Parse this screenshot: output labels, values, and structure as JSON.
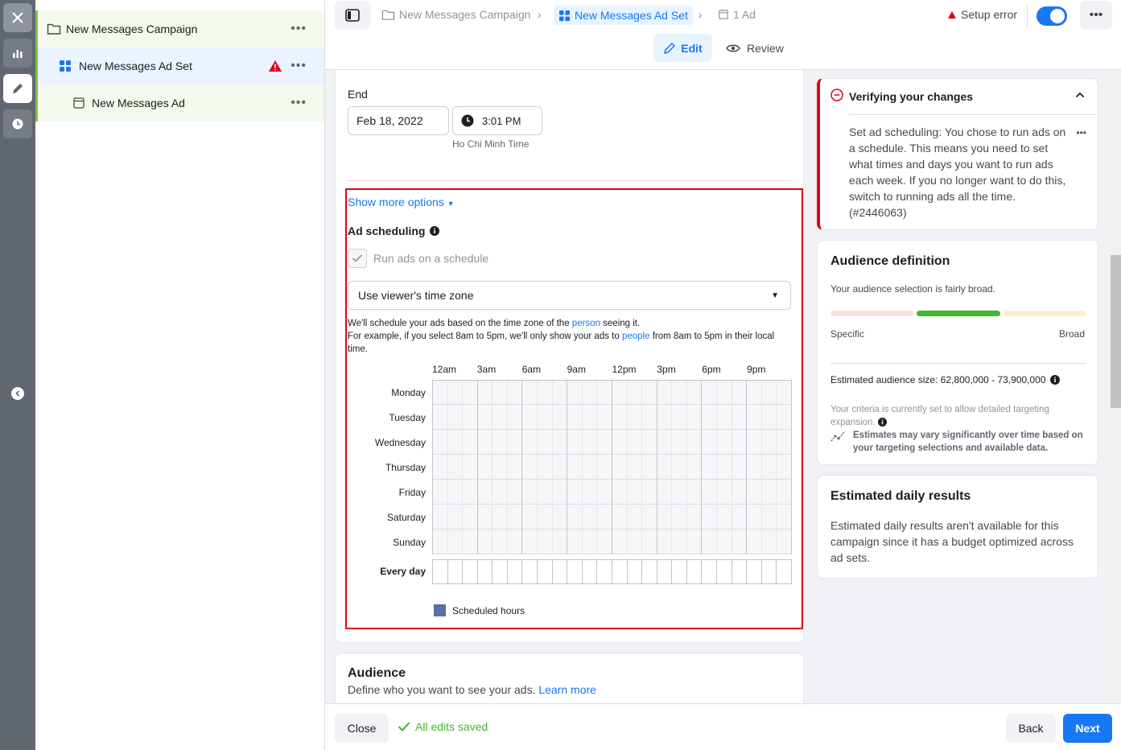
{
  "tree": {
    "campaign": "New Messages Campaign",
    "adset": "New Messages Ad Set",
    "ad": "New Messages Ad"
  },
  "header": {
    "crumb_campaign": "New Messages Campaign",
    "crumb_adset": "New Messages Ad Set",
    "crumb_ad": "1 Ad",
    "setup_error": "Setup error",
    "edit": "Edit",
    "review": "Review"
  },
  "schedule": {
    "end_label": "End",
    "end_date": "Feb 18, 2022",
    "end_time": "3:01 PM",
    "timezone_note": "Ho Chi Minh Time",
    "show_more": "Show more options",
    "ad_scheduling": "Ad scheduling",
    "run_on_schedule": "Run ads on a schedule",
    "tz_select": "Use viewer's time zone",
    "desc1_a": "We'll schedule your ads based on the time zone of the ",
    "desc1_link": "person",
    "desc1_b": " seeing it.",
    "desc2_a": "For example, if you select 8am to 5pm, we'll only show your ads to ",
    "desc2_link": "people",
    "desc2_b": " from 8am to 5pm in their local time.",
    "hours": [
      "12am",
      "3am",
      "6am",
      "9am",
      "12pm",
      "3pm",
      "6pm",
      "9pm"
    ],
    "days": [
      "Monday",
      "Tuesday",
      "Wednesday",
      "Thursday",
      "Friday",
      "Saturday",
      "Sunday"
    ],
    "every_day": "Every day",
    "legend": "Scheduled hours"
  },
  "audience": {
    "title": "Audience",
    "desc": "Define who you want to see your ads.",
    "learn_more": "Learn more"
  },
  "verify": {
    "title": "Verifying your changes",
    "body": "Set ad scheduling: You chose to run ads on a schedule. This means you need to set what times and days you want to run ads each week. If you no longer want to do this, switch to running ads all the time. (#2446063)"
  },
  "audience_def": {
    "title": "Audience definition",
    "note": "Your audience selection is fairly broad.",
    "specific": "Specific",
    "broad": "Broad",
    "size": "Estimated audience size: 62,800,000 - 73,900,000",
    "criteria": "Your criteria is currently set to allow detailed targeting expansion.",
    "estimates": "Estimates may vary significantly over time based on your targeting selections and available data."
  },
  "daily": {
    "title": "Estimated daily results",
    "body": "Estimated daily results aren't available for this campaign since it has a budget optimized across ad sets."
  },
  "footer": {
    "close": "Close",
    "saved": "All edits saved",
    "back": "Back",
    "next": "Next"
  },
  "colors": {
    "accent": "#1877f2",
    "error": "#e0021b",
    "success": "#42b72a"
  }
}
